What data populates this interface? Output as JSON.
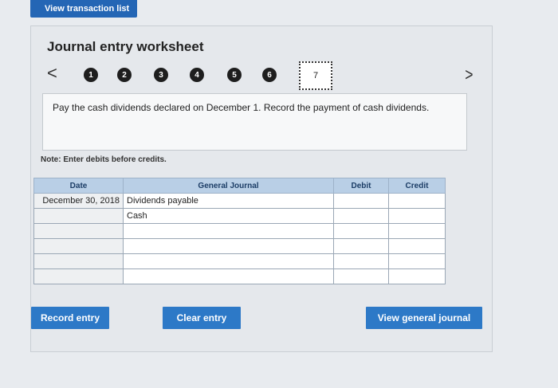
{
  "top_button": "View transaction list",
  "worksheet": {
    "title": "Journal entry worksheet",
    "prev_icon": "<",
    "next_icon": ">",
    "steps": [
      "1",
      "2",
      "3",
      "4",
      "5",
      "6",
      "7"
    ],
    "active_step": "7",
    "instruction": "Pay the cash dividends declared on December 1. Record the payment of cash dividends.",
    "note": "Note: Enter debits before credits.",
    "table": {
      "headers": [
        "Date",
        "General Journal",
        "Debit",
        "Credit"
      ],
      "rows": [
        {
          "date": "December 30, 2018",
          "account": "Dividends payable",
          "debit": "",
          "credit": ""
        },
        {
          "date": "",
          "account": "Cash",
          "debit": "",
          "credit": ""
        },
        {
          "date": "",
          "account": "",
          "debit": "",
          "credit": ""
        },
        {
          "date": "",
          "account": "",
          "debit": "",
          "credit": ""
        },
        {
          "date": "",
          "account": "",
          "debit": "",
          "credit": ""
        },
        {
          "date": "",
          "account": "",
          "debit": "",
          "credit": ""
        }
      ]
    },
    "buttons": {
      "record": "Record entry",
      "clear": "Clear entry",
      "view": "View general journal"
    }
  }
}
